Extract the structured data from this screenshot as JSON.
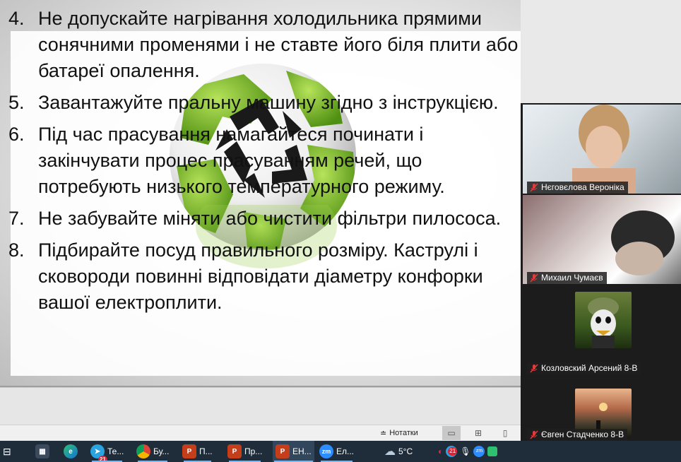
{
  "slide": {
    "items": [
      {
        "num": "4.",
        "text": "Не допускайте нагрівання холодильника прямими сонячними променями і не ставте його біля плити або батареї опалення."
      },
      {
        "num": "5.",
        "text": "Завантажуйте пральну машину згідно з інструкцією."
      },
      {
        "num": "6.",
        "text": "Під час прасування намагайтеся починати і закінчувати процес прасуванням речей, що потребують низького температурного режиму."
      },
      {
        "num": "7.",
        "text": "Не забувайте міняти або чистити фільтри пилососа."
      },
      {
        "num": "8.",
        "text": "Підбирайте посуд правильного розміру. Каструлі і сковороди повинні відповідати діаметру конфорки вашої електроплити."
      }
    ]
  },
  "statusbar": {
    "notes_label": "Нотатки"
  },
  "participants": [
    {
      "name": "Нєговєлова Вероніка",
      "mic": "muted"
    },
    {
      "name": "Михаил Чумаєв",
      "mic": "muted"
    },
    {
      "name": "Козловский Арсений 8-В",
      "mic": "muted"
    },
    {
      "name": "Євген Стадченко 8-В",
      "mic": "muted"
    }
  ],
  "taskbar": {
    "items": [
      {
        "icon": "task-view-icon",
        "label": ""
      },
      {
        "icon": "calculator-icon",
        "label": ""
      },
      {
        "icon": "edge-icon",
        "label": ""
      },
      {
        "icon": "telegram-icon",
        "label": "Те...",
        "badge": "21"
      },
      {
        "icon": "chrome-icon",
        "label": "Бу..."
      },
      {
        "icon": "powerpoint-icon",
        "label": "П..."
      },
      {
        "icon": "powerpoint-icon",
        "label": "Пр..."
      },
      {
        "icon": "powerpoint-icon",
        "label": "ЕН..."
      },
      {
        "icon": "zoom-icon",
        "label": "Ел..."
      }
    ],
    "weather": "5°C",
    "tray_badge": "21"
  },
  "colors": {
    "taskbar_bg": "#1f2c3a",
    "globe_green": "#7cc02a",
    "recycle_black": "#1a1a1a",
    "muted_red": "#e23b3b"
  }
}
